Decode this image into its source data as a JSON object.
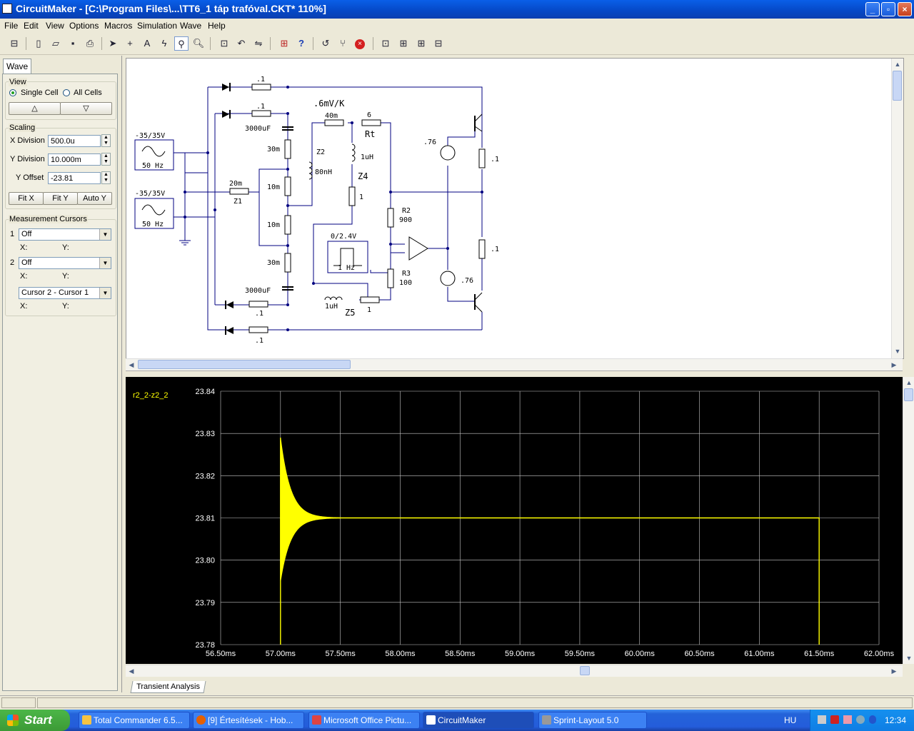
{
  "window": {
    "title": "CircuitMaker - [C:\\Program Files\\...\\TT6_1 táp trafóval.CKT* 110%]"
  },
  "menu": [
    "File",
    "Edit",
    "View",
    "Options",
    "Macros",
    "Simulation",
    "Wave",
    "Help"
  ],
  "toolbar_icons": [
    "hierarchy-icon",
    "new-icon",
    "open-icon",
    "save-icon",
    "print-icon",
    "arrow-tool-icon",
    "wire-tool-icon",
    "text-tool-icon",
    "probe-tool-icon",
    "wave-probe-icon",
    "zoom-icon",
    "zoom-fit-icon",
    "rotate-icon",
    "mirror-icon",
    "digital-sim-icon",
    "help-icon",
    "reset-icon",
    "step-icon",
    "stop-icon",
    "graph1-icon",
    "graph2-icon",
    "graph3-icon",
    "graph4-icon"
  ],
  "panel": {
    "tab": "Wave",
    "view": {
      "legend": "View",
      "single": "Single Cell",
      "all": "All Cells",
      "selected": "single",
      "up": "△",
      "down": "▽"
    },
    "scaling": {
      "legend": "Scaling",
      "xdiv_label": "X Division",
      "xdiv": "500.0u",
      "ydiv_label": "Y Division",
      "ydiv": "10.000m",
      "yoff_label": "Y Offset",
      "yoff": "-23.81",
      "fitx": "Fit X",
      "fity": "Fit Y",
      "autoy": "Auto Y"
    },
    "cursors": {
      "legend": "Measurement Cursors",
      "c1_num": "1",
      "c1": "Off",
      "c1x": "X:",
      "c1y": "Y:",
      "c2_num": "2",
      "c2": "Off",
      "c2x": "X:",
      "c2y": "Y:",
      "diff": "Cursor 2 - Cursor 1",
      "dx": "X:",
      "dy": "Y:"
    }
  },
  "schematic": {
    "labels": {
      "src1": "-35/35V",
      "src1f": "50 Hz",
      "src2": "-35/35V",
      "src2f": "50 Hz",
      "r_top1": ".1",
      "r_top2": ".1",
      "c_top": "3000uF",
      "r30a": "30m",
      "r10a": "10m",
      "r10b": "10m",
      "r30b": "30m",
      "c_bot": "3000uF",
      "r_bot1": ".1",
      "r_bot2": ".1",
      "r20": "20m",
      "z1": "Z1",
      "tc": ".6mV/K",
      "r40": "40m",
      "r6": "6",
      "rt": "Rt",
      "z2": "Z2",
      "l80": "80nH",
      "l1u": "1uH",
      "z4": "Z4",
      "r1": "1",
      "r2": "R2",
      "r2v": "900",
      "r3": "R3",
      "r3v": "100",
      "pulse": "0/2.4V",
      "pulsef": "1 Hz",
      "l1u2": "1uH",
      "z5": "Z5",
      "r1b": "1",
      "v76a": ".76",
      "v76b": ".76",
      "rq1": ".1",
      "rq2": ".1"
    }
  },
  "wave": {
    "trace_label": "r2_2-z2_2",
    "tab": "Transient Analysis",
    "trace_color": "#FFFF00",
    "grid_color": "#C8C8C8"
  },
  "chart_data": {
    "type": "line",
    "title": "",
    "xlabel": "",
    "ylabel": "",
    "series": [
      {
        "name": "r2_2-z2_2"
      }
    ],
    "x_ticks": [
      "56.50ms",
      "57.00ms",
      "57.50ms",
      "58.00ms",
      "58.50ms",
      "59.00ms",
      "59.50ms",
      "60.00ms",
      "60.50ms",
      "61.00ms",
      "61.50ms",
      "62.00ms"
    ],
    "y_ticks": [
      "23.84",
      "23.83",
      "23.82",
      "23.81",
      "23.80",
      "23.79",
      "23.78"
    ],
    "xlim": [
      56.5,
      62.0
    ],
    "ylim": [
      23.78,
      23.84
    ],
    "grid": true,
    "trace": {
      "start_ms": 57.0,
      "end_ms": 61.5,
      "settled_value": 23.81,
      "ringing_peak_high": 23.829,
      "ringing_peak_low": 23.795,
      "ringing_decay_ms": 0.5,
      "rise_from": 23.78,
      "drop_to": 23.78
    }
  },
  "taskbar": {
    "start": "Start",
    "tasks": [
      "Total Commander 6.5...",
      "[9] Értesítések - Hob...",
      "Microsoft Office Pictu...",
      "CircuitMaker",
      "Sprint-Layout 5.0"
    ],
    "lang": "HU",
    "clock": "12:34"
  }
}
